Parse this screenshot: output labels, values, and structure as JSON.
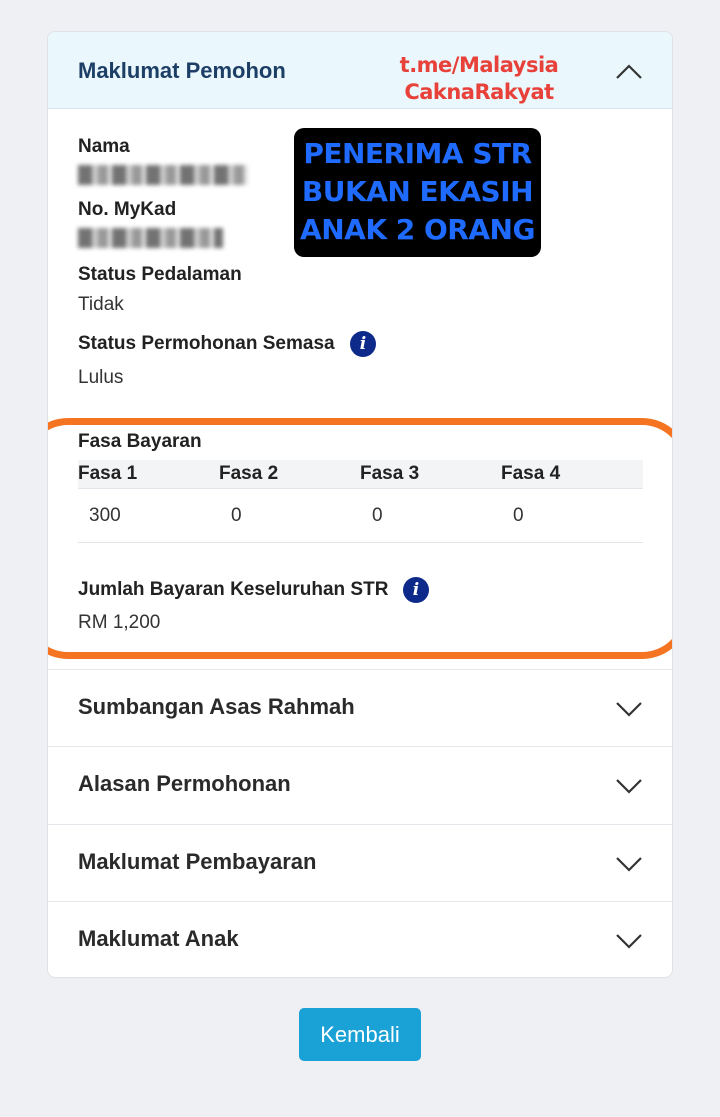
{
  "header": {
    "title": "Maklumat Pemohon"
  },
  "watermark": {
    "line1": "t.me/Malaysia",
    "line2": "CaknaRakyat"
  },
  "overlay_banner": {
    "line1": "PENERIMA STR",
    "line2": "BUKAN EKASIH",
    "line3": "ANAK 2 ORANG"
  },
  "fields": {
    "nama_label": "Nama",
    "mykad_label": "No. MyKad",
    "pedalaman_label": "Status Pedalaman",
    "pedalaman_value": "Tidak",
    "permohonan_label": "Status Permohonan Semasa",
    "permohonan_value": "Lulus"
  },
  "fasa": {
    "title": "Fasa Bayaran",
    "headers": [
      "Fasa 1",
      "Fasa 2",
      "Fasa 3",
      "Fasa 4"
    ],
    "values": [
      "300",
      "0",
      "0",
      "0"
    ]
  },
  "jumlah": {
    "label": "Jumlah Bayaran Keseluruhan STR",
    "value": "RM 1,200"
  },
  "info_glyph": "i",
  "sections": [
    {
      "label": "Sumbangan Asas Rahmah"
    },
    {
      "label": "Alasan Permohonan"
    },
    {
      "label": "Maklumat Pembayaran"
    },
    {
      "label": "Maklumat Anak"
    }
  ],
  "back_button": "Kembali",
  "colors": {
    "accent": "#1aa1d6",
    "highlight": "#f47422",
    "title": "#1d3f66"
  }
}
